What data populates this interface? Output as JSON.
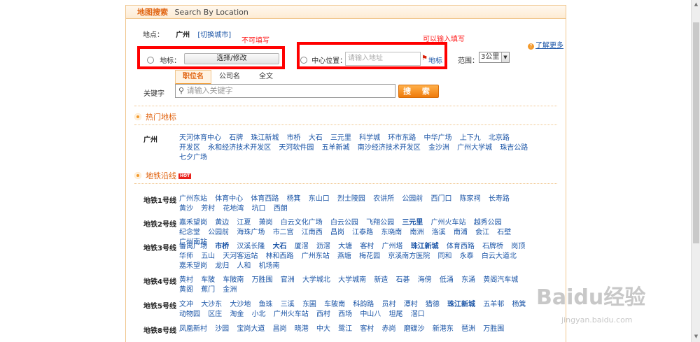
{
  "header": {
    "title_cn": "地图搜索",
    "title_en": "Search By Location"
  },
  "location": {
    "label": "地点：",
    "city": "广州",
    "switch": "[切换城市]"
  },
  "learn_more": "了解更多",
  "annotations": {
    "not_editable": "不可填写",
    "editable": "可以输入填写"
  },
  "landmark": {
    "label": "地标：",
    "button": "选择/修改"
  },
  "center": {
    "label": "中心位置：",
    "placeholder": "请输入地址",
    "pin_label": "地标"
  },
  "range": {
    "label": "范围：",
    "value": "3公里"
  },
  "tabs": [
    "职位名",
    "公司名",
    "全文"
  ],
  "keyword": {
    "label": "关键字",
    "placeholder": "请输入关键字",
    "button": "搜 索"
  },
  "sections": {
    "hot_landmarks": "热门地标",
    "metro": "地铁沿线",
    "hot_badge": "HOT"
  },
  "hot_landmarks": {
    "city": "广州",
    "items": [
      "天河体育中心",
      "石牌",
      "珠江新城",
      "市桥",
      "大石",
      "三元里",
      "科学城",
      "环市东路",
      "中华广场",
      "上下九",
      "北京路",
      "开发区",
      "永和经济技术开发区",
      "天河软件园",
      "五羊新城",
      "南沙经济技术开发区",
      "金沙洲",
      "广州大学城",
      "珠吉公路",
      "七夕广场"
    ]
  },
  "metro": [
    {
      "line": "地铁1号线",
      "stations": [
        "广州东站",
        "体育中心",
        "体育西路",
        "杨箕",
        "东山口",
        "烈士陵园",
        "农讲所",
        "公园前",
        "西门口",
        "陈家祠",
        "长寿路",
        "黄沙",
        "芳村",
        "花地湾",
        "坑口",
        "西朗"
      ]
    },
    {
      "line": "地铁2号线",
      "stations": [
        "嘉禾望岗",
        "黄边",
        "江夏",
        "萧岗",
        "白云文化广场",
        "白云公园",
        "飞翔公园",
        "三元里",
        "广州火车站",
        "越秀公园",
        "纪念堂",
        "公园前",
        "海珠广场",
        "市二宫",
        "江南西",
        "昌岗",
        "江泰路",
        "东晓南",
        "南洲",
        "洛溪",
        "南浦",
        "会江",
        "石壁",
        "广州南站"
      ]
    },
    {
      "line": "地铁3号线",
      "stations": [
        "番禺广场",
        "市桥",
        "汉溪长隆",
        "大石",
        "厦滘",
        "沥滘",
        "大塘",
        "客村",
        "广州塔",
        "珠江新城",
        "体育西路",
        "石牌桥",
        "岗顶",
        "华师",
        "五山",
        "天河客运站",
        "林和西路",
        "广州东站",
        "燕塘",
        "梅花园",
        "京溪南方医院",
        "同和",
        "永泰",
        "白云大道北",
        "嘉禾望岗",
        "龙归",
        "人和",
        "机场南"
      ]
    },
    {
      "line": "地铁4号线",
      "stations": [
        "黄村",
        "车陂",
        "车陂南",
        "万胜围",
        "官洲",
        "大学城北",
        "大学城南",
        "新造",
        "石碁",
        "海傍",
        "低涌",
        "东涌",
        "黄阁汽车城",
        "黄阁",
        "蕉门",
        "金洲"
      ]
    },
    {
      "line": "地铁5号线",
      "stations": [
        "文冲",
        "大沙东",
        "大沙地",
        "鱼珠",
        "三溪",
        "东圃",
        "车陂南",
        "科韵路",
        "员村",
        "潭村",
        "猎德",
        "珠江新城",
        "五羊邨",
        "杨箕",
        "动物园",
        "区庄",
        "淘金",
        "小北",
        "广州火车站",
        "西村",
        "西场",
        "中山八",
        "坦尾",
        "滘口"
      ]
    },
    {
      "line": "地铁8号线",
      "stations": [
        "凤凰新村",
        "沙园",
        "宝岗大道",
        "昌岗",
        "晓港",
        "中大",
        "鹭江",
        "客村",
        "赤岗",
        "磨碟沙",
        "新港东",
        "琶洲",
        "万胜围"
      ]
    }
  ],
  "watermark": {
    "brand": "Baidu经验",
    "url": "jingyan.baidu.com"
  }
}
